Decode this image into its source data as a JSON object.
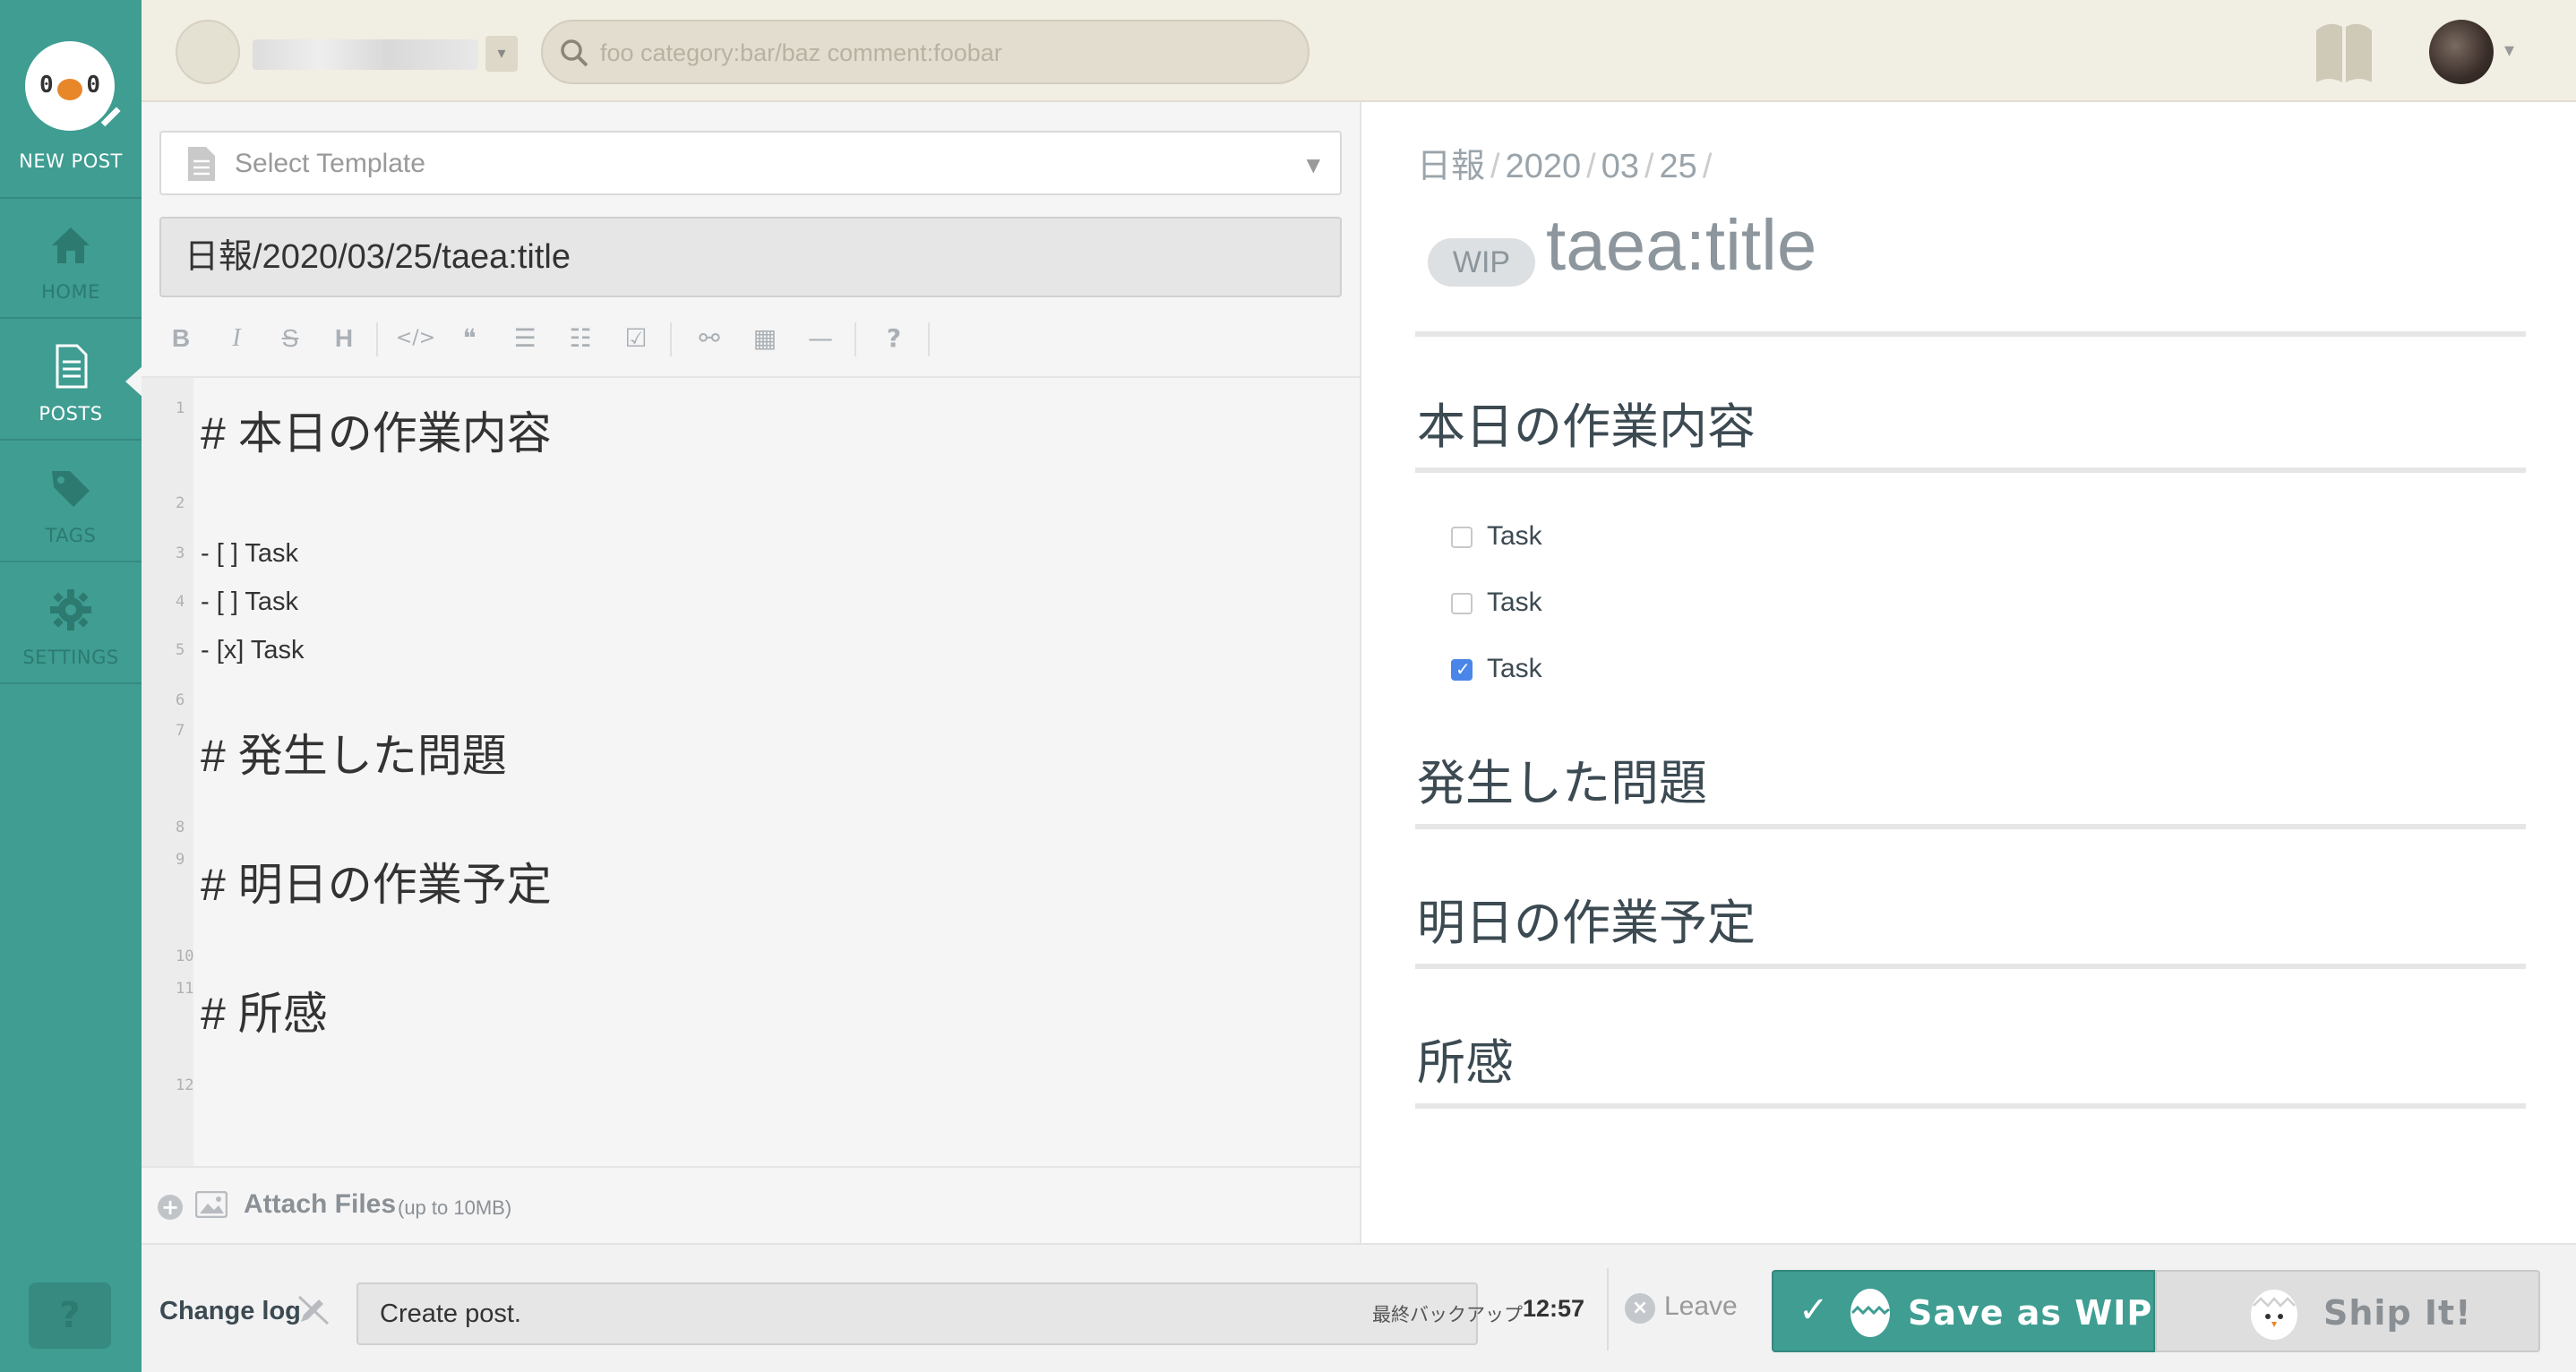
{
  "sidebar": {
    "new_post_label": "NEW POST",
    "items": [
      {
        "label": "HOME",
        "icon": "home-icon"
      },
      {
        "label": "POSTS",
        "icon": "document-icon"
      },
      {
        "label": "TAGS",
        "icon": "tag-icon"
      },
      {
        "label": "SETTINGS",
        "icon": "gear-icon"
      }
    ],
    "active_item": "POSTS",
    "help_label": "?",
    "logo_eye": "0"
  },
  "topbar": {
    "search_placeholder": "foo category:bar/baz comment:foobar"
  },
  "editor": {
    "template_placeholder": "Select Template",
    "title_value": "日報/2020/03/25/taea:title",
    "toolbar": [
      "B",
      "I",
      "S",
      "H",
      "</>",
      "❝",
      "☰",
      "☷",
      "☑",
      "⚯",
      "▦",
      "—",
      "?"
    ],
    "lines": [
      {
        "num": "1",
        "text": "# 本日の作業内容",
        "kind": "h1"
      },
      {
        "num": "2",
        "text": "",
        "kind": "blank"
      },
      {
        "num": "3",
        "text": "- [ ] Task",
        "kind": "li"
      },
      {
        "num": "4",
        "text": "- [ ] Task",
        "kind": "li"
      },
      {
        "num": "5",
        "text": "- [x] Task",
        "kind": "li"
      },
      {
        "num": "6",
        "text": "",
        "kind": "blank"
      },
      {
        "num": "7",
        "text": "# 発生した問題",
        "kind": "h1"
      },
      {
        "num": "8",
        "text": "",
        "kind": "blank"
      },
      {
        "num": "9",
        "text": "# 明日の作業予定",
        "kind": "h1"
      },
      {
        "num": "10",
        "text": "",
        "kind": "blank"
      },
      {
        "num": "11",
        "text": "# 所感",
        "kind": "h1"
      },
      {
        "num": "12",
        "text": "",
        "kind": "blank"
      }
    ],
    "attach_label": "Attach Files",
    "attach_note": "(up to 10MB)",
    "attach_plus": "+"
  },
  "preview": {
    "breadcrumb": [
      "日報",
      "2020",
      "03",
      "25"
    ],
    "breadcrumb_sep": "/",
    "wip_badge": "WIP",
    "title": "taea:title",
    "headings": [
      "本日の作業内容",
      "発生した問題",
      "明日の作業予定",
      "所感"
    ],
    "tasks": [
      {
        "label": "Task",
        "checked": false
      },
      {
        "label": "Task",
        "checked": false
      },
      {
        "label": "Task",
        "checked": true
      }
    ]
  },
  "bottombar": {
    "changelog_label": "Change log",
    "changelog_value": "Create post.",
    "backup_label": "最終バックアップ",
    "backup_time": "12:57",
    "leave_label": "Leave",
    "save_wip_label": "Save as WIP",
    "ship_label": "Ship It!"
  },
  "colors": {
    "brand": "#3f9d92",
    "topbar_bg": "#f1eee3",
    "checkbox_checked": "#4a86e8"
  }
}
